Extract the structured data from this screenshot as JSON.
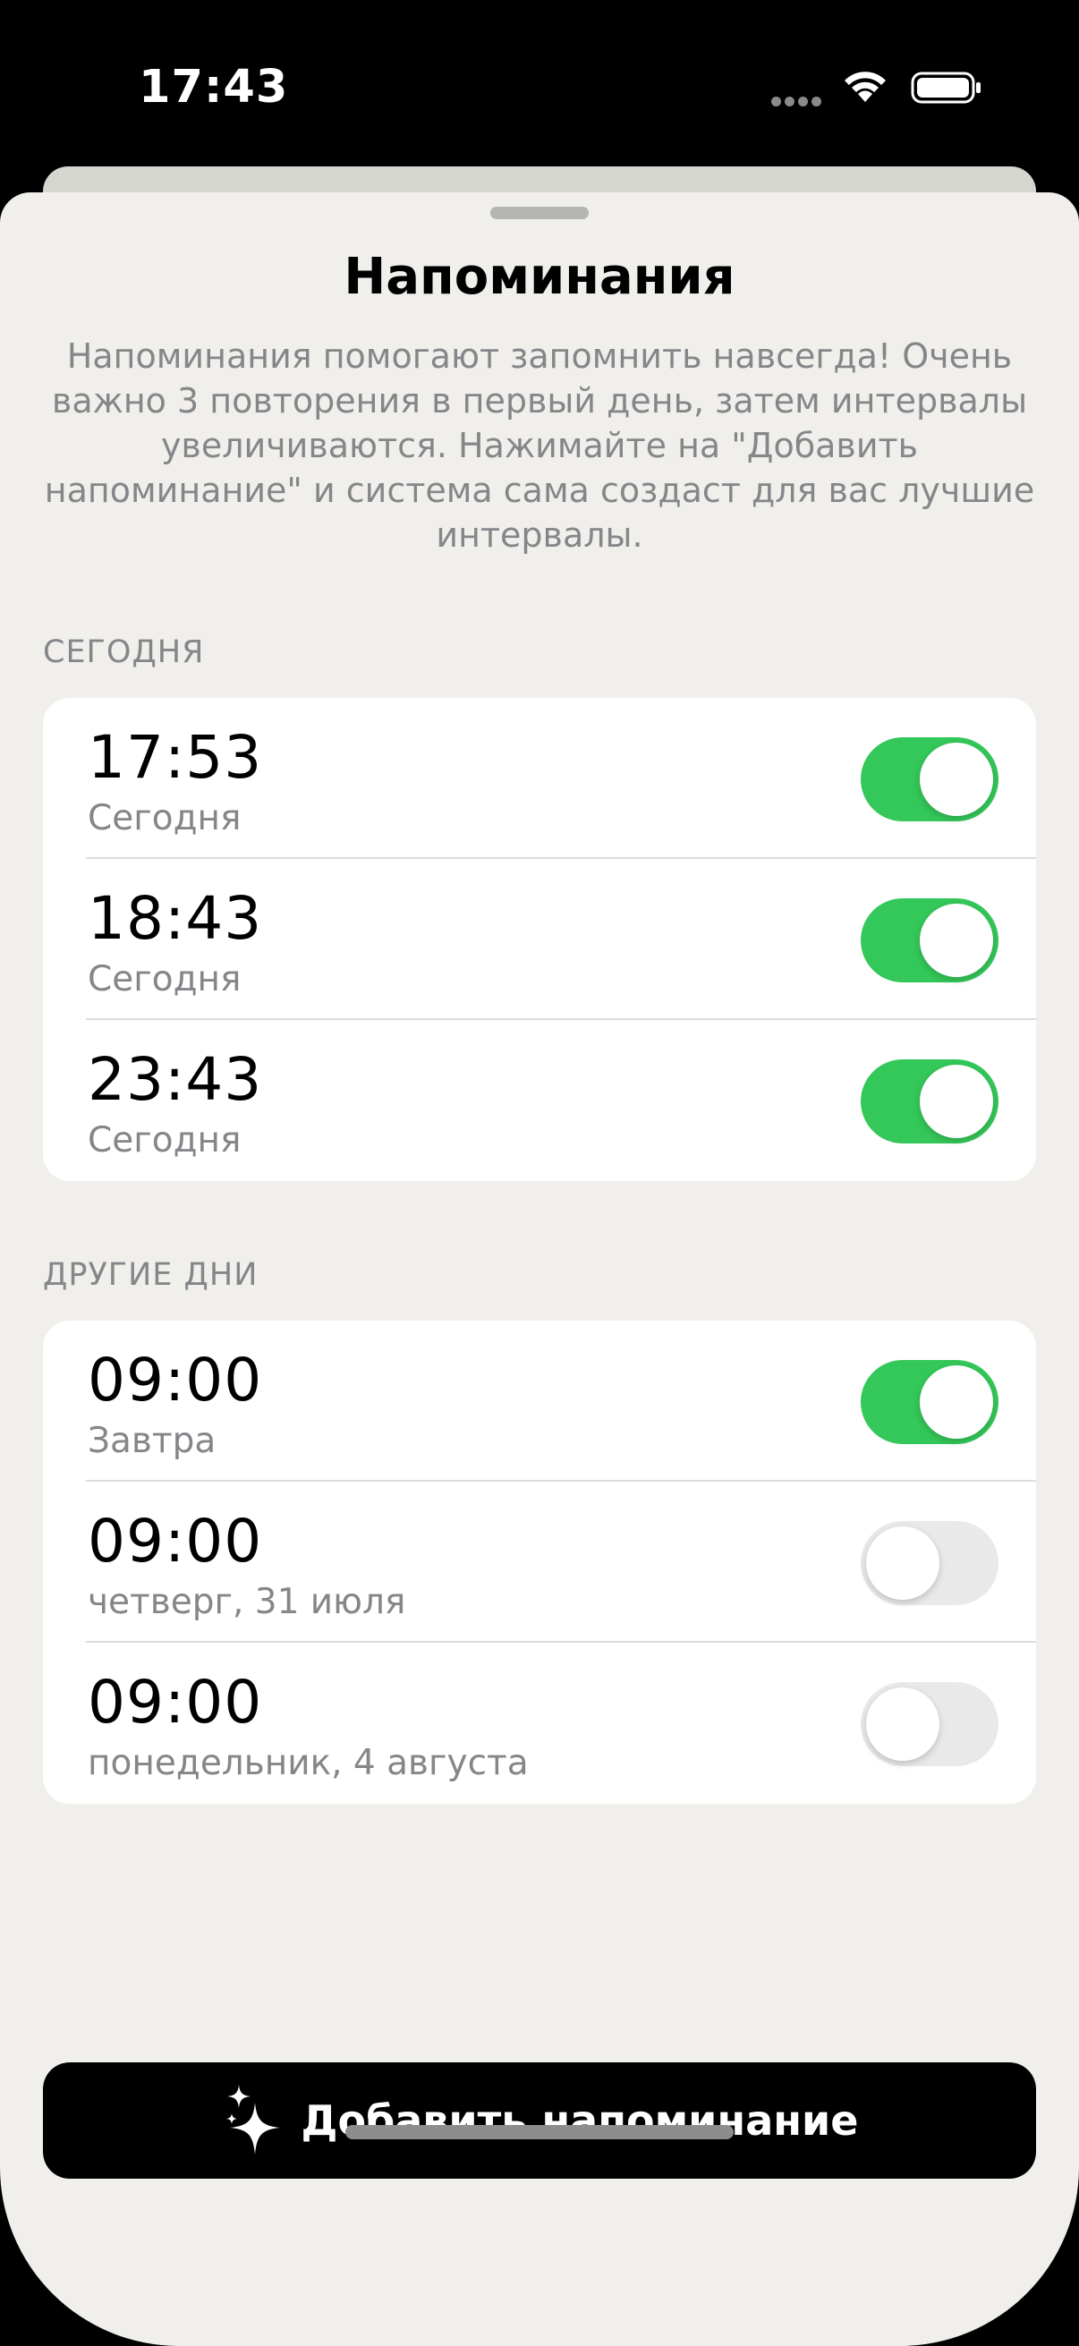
{
  "status_bar": {
    "time": "17:43",
    "wifi_icon": "wifi-icon",
    "battery_icon": "battery-icon"
  },
  "sheet": {
    "title": "Напоминания",
    "description": "Напоминания помогают запомнить навсегда! Очень важно 3 повторения в первый день, затем интервалы увеличиваются. Нажимайте на \"Добавить напоминание\" и система сама создаст для вас лучшие интервалы."
  },
  "sections": [
    {
      "header": "СЕГОДНЯ",
      "rows": [
        {
          "time": "17:53",
          "subtitle": "Сегодня",
          "enabled": true
        },
        {
          "time": "18:43",
          "subtitle": "Сегодня",
          "enabled": true
        },
        {
          "time": "23:43",
          "subtitle": "Сегодня",
          "enabled": true
        }
      ]
    },
    {
      "header": "ДРУГИЕ ДНИ",
      "rows": [
        {
          "time": "09:00",
          "subtitle": "Завтра",
          "enabled": true
        },
        {
          "time": "09:00",
          "subtitle": "четверг, 31 июля",
          "enabled": false
        },
        {
          "time": "09:00",
          "subtitle": "понедельник, 4 августа",
          "enabled": false
        }
      ]
    }
  ],
  "add_button": {
    "label": "Добавить напоминание",
    "icon": "sparkles-icon"
  },
  "colors": {
    "toggle_on": "#34c759",
    "toggle_off": "#e9e9ea",
    "sheet_background": "#f0efeb",
    "secondary_text": "#86868a"
  }
}
